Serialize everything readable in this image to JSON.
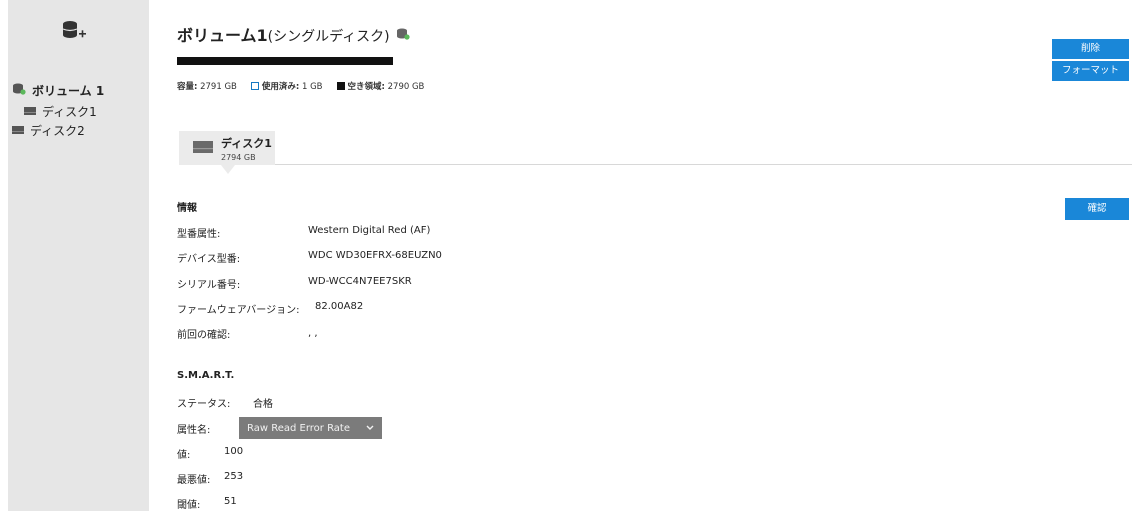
{
  "sidebar": {
    "volume_label": "ボリューム 1",
    "disk1_label": "ディスク1",
    "disk2_label": "ディスク2"
  },
  "volume": {
    "title": "ボリューム1",
    "type": "(シングルディスク)",
    "capacity_label": "容量:",
    "capacity_value": "2791 GB",
    "used_label": "使用済み:",
    "used_value": "1 GB",
    "free_label": "空き領域:",
    "free_value": "2790 GB"
  },
  "actions": {
    "delete_label": "削除",
    "format_label": "フォーマット",
    "confirm_label": "確認"
  },
  "disk_tab": {
    "name": "ディスク1",
    "size": "2794 GB"
  },
  "info": {
    "heading": "情報",
    "rows": [
      {
        "label": "型番属性:",
        "value": "Western Digital Red (AF)"
      },
      {
        "label": "デバイス型番:",
        "value": "WDC WD30EFRX-68EUZN0"
      },
      {
        "label": "シリアル番号:",
        "value": "WD-WCC4N7EE7SKR"
      },
      {
        "label": "ファームウェアバージョン:",
        "value": "82.00A82"
      },
      {
        "label": "前回の確認:",
        "value": ", ,"
      }
    ]
  },
  "smart": {
    "heading": "S.M.A.R.T.",
    "status_label": "ステータス:",
    "status_value": "合格",
    "attr_label": "属性名:",
    "attr_selected": "Raw Read Error Rate",
    "value_label": "値:",
    "value": "100",
    "worst_label": "最悪値:",
    "worst": "253",
    "threshold_label": "閾値:",
    "threshold": "51"
  },
  "colors": {
    "accent": "#1a87d8",
    "sidebar_bg": "#e6e6e6",
    "status_ok": "#5cb85c"
  }
}
